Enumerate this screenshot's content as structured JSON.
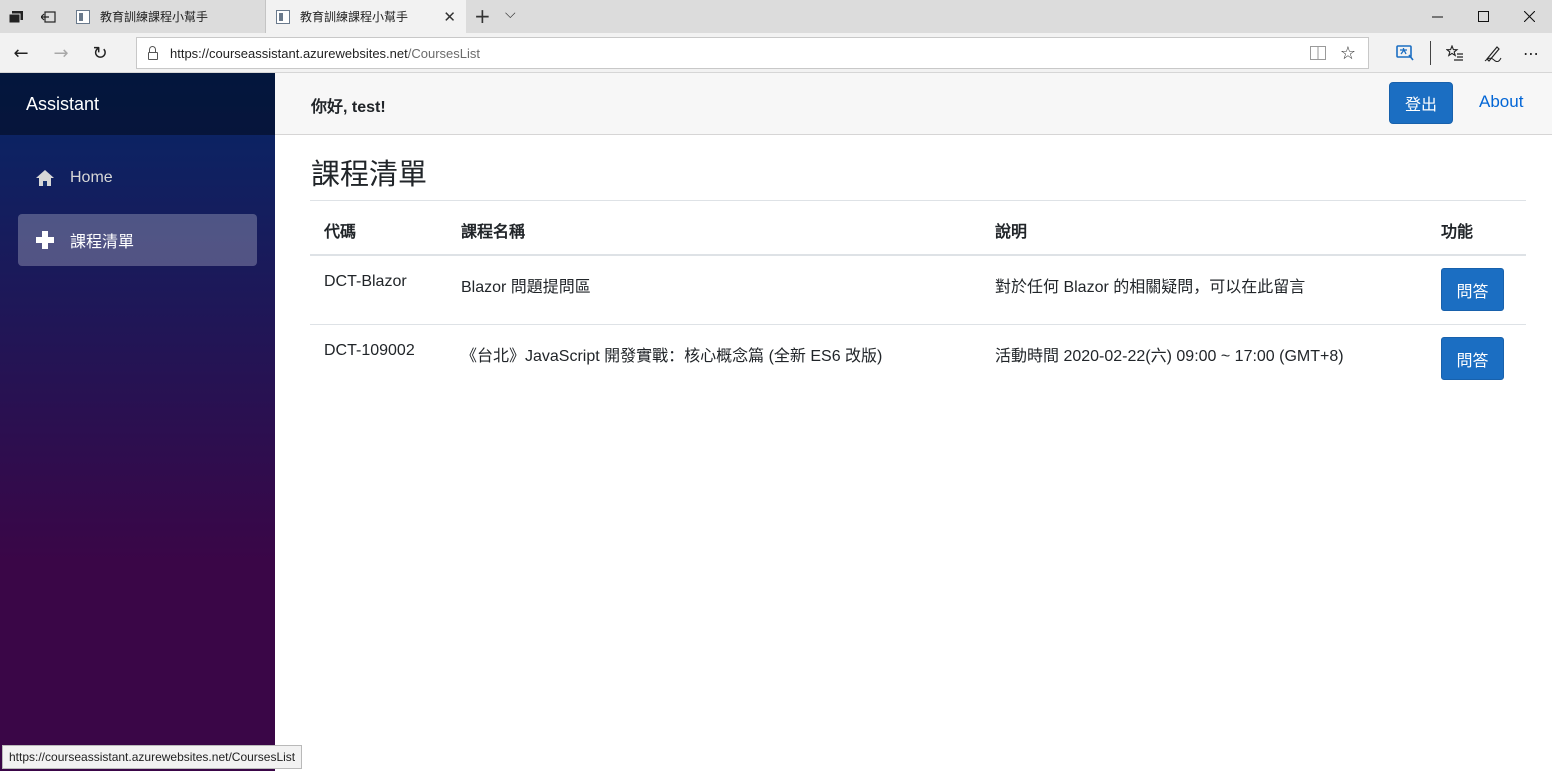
{
  "browser": {
    "tabs": [
      {
        "title": "教育訓練課程小幫手",
        "active": false
      },
      {
        "title": "教育訓練課程小幫手",
        "active": true
      }
    ],
    "url_base": "https://courseassistant.azurewebsites.net",
    "url_path": "/CoursesList",
    "status_url": "https://courseassistant.azurewebsites.net/CoursesList",
    "icons": {
      "tab_actions": "tab-actions-icon",
      "set_aside": "set-aside-tabs-icon",
      "new_tab": "+",
      "tab_list": "⌵",
      "back": "←",
      "forward": "→",
      "refresh": "↻",
      "star": "☆",
      "minimize": "—",
      "maximize": "☐",
      "close": "✕",
      "more": "⋯"
    }
  },
  "sidebar": {
    "brand": "Assistant",
    "items": [
      {
        "label": "Home",
        "icon": "home-icon",
        "active": false
      },
      {
        "label": "課程清單",
        "icon": "plus-icon",
        "active": true
      }
    ]
  },
  "topbar": {
    "greeting": "你好, test!",
    "logout_label": "登出",
    "about_label": "About"
  },
  "main": {
    "title": "課程清單",
    "columns": [
      "代碼",
      "課程名稱",
      "說明",
      "功能"
    ],
    "rows": [
      {
        "code": "DCT-Blazor",
        "name": "Blazor 問題提問區",
        "description": "對於任何 Blazor 的相關疑問，可以在此留言",
        "action": "問答"
      },
      {
        "code": "DCT-109002",
        "name": "《台北》JavaScript 開發實戰：核心概念篇 (全新 ES6 改版)",
        "description": "活動時間 2020-02-22(六) 09:00 ~ 17:00 (GMT+8)",
        "action": "問答"
      }
    ]
  },
  "colors": {
    "primary": "#1b6ec2",
    "sidebar_top": "#052767",
    "sidebar_bottom": "#3a0647",
    "link": "#0366d6"
  }
}
